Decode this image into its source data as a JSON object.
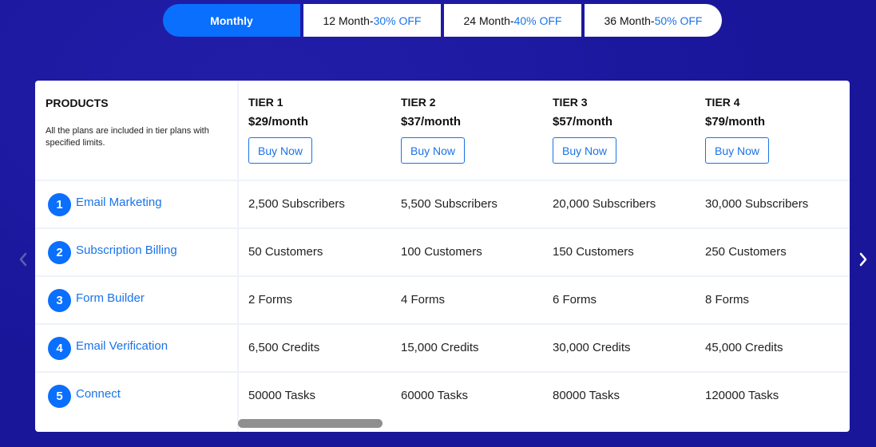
{
  "billing_tabs": [
    {
      "label": "Monthly",
      "discount": "",
      "active": true
    },
    {
      "label": "12 Month",
      "discount": "30% OFF",
      "active": false
    },
    {
      "label": "24 Month",
      "discount": "40% OFF",
      "active": false
    },
    {
      "label": "36 Month",
      "discount": "50% OFF",
      "active": false
    }
  ],
  "tab_separator": " - ",
  "products_header": {
    "title": "PRODUCTS",
    "description": "All the plans are included in tier plans with specified limits."
  },
  "tiers": [
    {
      "name": "TIER 1",
      "price": "$29/month",
      "button": "Buy Now"
    },
    {
      "name": "TIER 2",
      "price": "$37/month",
      "button": "Buy Now"
    },
    {
      "name": "TIER 3",
      "price": "$57/month",
      "button": "Buy Now"
    },
    {
      "name": "TIER 4",
      "price": "$79/month",
      "button": "Buy Now"
    }
  ],
  "products": [
    {
      "number": "1",
      "name": "Email Marketing",
      "values": [
        "2,500 Subscribers",
        "5,500 Subscribers",
        "20,000 Subscribers",
        "30,000 Subscribers"
      ]
    },
    {
      "number": "2",
      "name": "Subscription Billing",
      "values": [
        "50 Customers",
        "100 Customers",
        "150 Customers",
        "250 Customers"
      ]
    },
    {
      "number": "3",
      "name": "Form Builder",
      "values": [
        "2 Forms",
        "4 Forms",
        "6 Forms",
        "8 Forms"
      ]
    },
    {
      "number": "4",
      "name": "Email Verification",
      "values": [
        "6,500 Credits",
        "15,000 Credits",
        "30,000 Credits",
        "45,000 Credits"
      ]
    },
    {
      "number": "5",
      "name": "Connect",
      "values": [
        "50000 Tasks",
        "60000 Tasks",
        "80000 Tasks",
        "120000 Tasks"
      ]
    }
  ],
  "colors": {
    "background": "#1a169a",
    "accent": "#0a6ffd",
    "link": "#1a73e8"
  },
  "icons": {
    "prev": "chevron-left-icon",
    "next": "chevron-right-icon"
  }
}
